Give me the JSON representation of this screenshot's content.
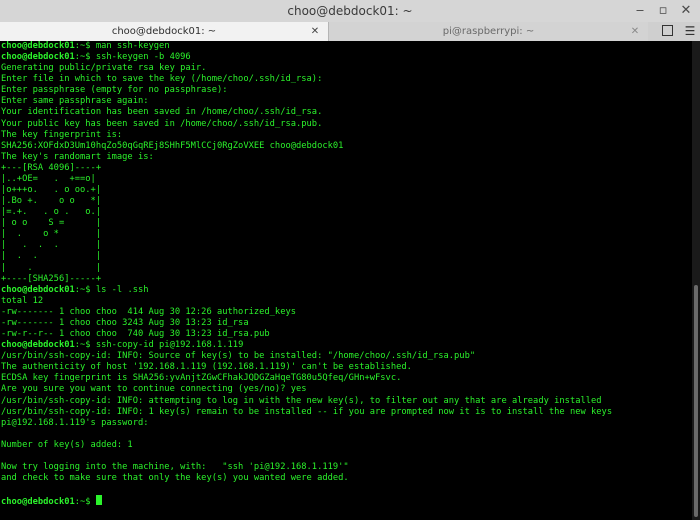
{
  "window": {
    "title": "choo@debdock01: ~",
    "minimize_glyph": "‒",
    "maximize_glyph": "▫",
    "close_glyph": "✕"
  },
  "tabs": [
    {
      "label": "choo@debdock01: ~",
      "active": true,
      "close_glyph": "✕"
    },
    {
      "label": "pi@raspberrypi: ~",
      "active": false,
      "close_glyph": "✕"
    }
  ],
  "toolbar": {
    "new_tab_icon": "new-tab-icon",
    "menu_glyph": "☰"
  },
  "terminal": {
    "colors": {
      "foreground": "#2bf22b",
      "background": "#000000"
    },
    "prompt_user": "choo@debdock01",
    "prompt_path": ":~$ ",
    "lines": [
      {
        "type": "prompt",
        "cmd": "man ssh-keygen"
      },
      {
        "type": "prompt",
        "cmd": "ssh-keygen -b 4096"
      },
      {
        "type": "out",
        "text": "Generating public/private rsa key pair."
      },
      {
        "type": "out",
        "text": "Enter file in which to save the key (/home/choo/.ssh/id_rsa):"
      },
      {
        "type": "out",
        "text": "Enter passphrase (empty for no passphrase):"
      },
      {
        "type": "out",
        "text": "Enter same passphrase again:"
      },
      {
        "type": "out",
        "text": "Your identification has been saved in /home/choo/.ssh/id_rsa."
      },
      {
        "type": "out",
        "text": "Your public key has been saved in /home/choo/.ssh/id_rsa.pub."
      },
      {
        "type": "out",
        "text": "The key fingerprint is:"
      },
      {
        "type": "out",
        "text": "SHA256:XOFdxD3Um10hqZo50qGqREj8SHhF5MlCCj0RgZoVXEE choo@debdock01"
      },
      {
        "type": "out",
        "text": "The key's randomart image is:"
      },
      {
        "type": "out",
        "text": "+---[RSA 4096]----+"
      },
      {
        "type": "out",
        "text": "|..+OE=   .  +==o|"
      },
      {
        "type": "out",
        "text": "|o+++o.   . o oo.+|"
      },
      {
        "type": "out",
        "text": "|.Bo +.    o o   *|"
      },
      {
        "type": "out",
        "text": "|=.+.   . o .   o.|"
      },
      {
        "type": "out",
        "text": "| o o    S =      |"
      },
      {
        "type": "out",
        "text": "|  .    o *       |"
      },
      {
        "type": "out",
        "text": "|   .  .  .       |"
      },
      {
        "type": "out",
        "text": "|  .  .           |"
      },
      {
        "type": "out",
        "text": "|    .            |"
      },
      {
        "type": "out",
        "text": "+----[SHA256]-----+"
      },
      {
        "type": "prompt",
        "cmd": "ls -l .ssh"
      },
      {
        "type": "out",
        "text": "total 12"
      },
      {
        "type": "out",
        "text": "-rw------- 1 choo choo  414 Aug 30 12:26 authorized_keys"
      },
      {
        "type": "out",
        "text": "-rw------- 1 choo choo 3243 Aug 30 13:23 id_rsa"
      },
      {
        "type": "out",
        "text": "-rw-r--r-- 1 choo choo  740 Aug 30 13:23 id_rsa.pub"
      },
      {
        "type": "prompt",
        "cmd": "ssh-copy-id pi@192.168.1.119"
      },
      {
        "type": "out",
        "text": "/usr/bin/ssh-copy-id: INFO: Source of key(s) to be installed: \"/home/choo/.ssh/id_rsa.pub\""
      },
      {
        "type": "out",
        "text": "The authenticity of host '192.168.1.119 (192.168.1.119)' can't be established."
      },
      {
        "type": "out",
        "text": "ECDSA key fingerprint is SHA256:yvAnjtZGwCFhakJQDGZaHqeTG80u5Qfeq/GHn+wFsvc."
      },
      {
        "type": "out",
        "text": "Are you sure you want to continue connecting (yes/no)? yes"
      },
      {
        "type": "out",
        "text": "/usr/bin/ssh-copy-id: INFO: attempting to log in with the new key(s), to filter out any that are already installed"
      },
      {
        "type": "out",
        "text": "/usr/bin/ssh-copy-id: INFO: 1 key(s) remain to be installed -- if you are prompted now it is to install the new keys"
      },
      {
        "type": "out",
        "text": "pi@192.168.1.119's password:"
      },
      {
        "type": "out",
        "text": ""
      },
      {
        "type": "out",
        "text": "Number of key(s) added: 1"
      },
      {
        "type": "out",
        "text": ""
      },
      {
        "type": "out",
        "text": "Now try logging into the machine, with:   \"ssh 'pi@192.168.1.119'\""
      },
      {
        "type": "out",
        "text": "and check to make sure that only the key(s) you wanted were added."
      },
      {
        "type": "out",
        "text": ""
      },
      {
        "type": "cursor",
        "cmd": ""
      }
    ]
  },
  "scrollbar": {
    "position_fraction": 0.52
  }
}
